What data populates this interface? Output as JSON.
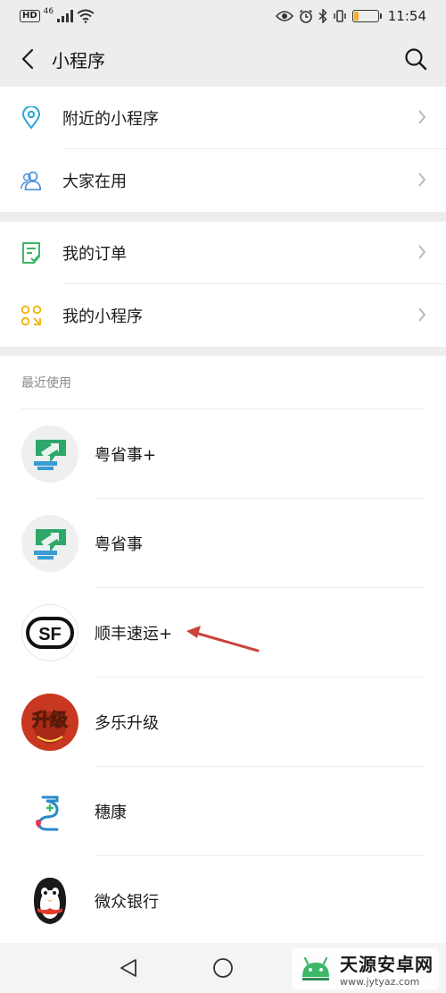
{
  "status_bar": {
    "hd": "HD",
    "network": "46",
    "time": "11:54",
    "battery_level": 0.2,
    "battery_color": "#f2b233"
  },
  "header": {
    "title": "小程序",
    "back_icon": "chevron-left-icon",
    "search_icon": "search-icon"
  },
  "menu_group_1": [
    {
      "label": "附近的小程序",
      "icon": "location-pin-icon",
      "icon_color": "#29a6d8"
    },
    {
      "label": "大家在用",
      "icon": "people-icon",
      "icon_color": "#4a8fd9"
    }
  ],
  "menu_group_2": [
    {
      "label": "我的订单",
      "icon": "order-list-icon",
      "icon_color": "#3cb868"
    },
    {
      "label": "我的小程序",
      "icon": "mini-program-grid-icon",
      "icon_color": "#f0b400"
    }
  ],
  "recent": {
    "header": "最近使用",
    "items": [
      {
        "name": "粤省事+",
        "icon": "yue-sheng-shi-logo-icon"
      },
      {
        "name": "粤省事",
        "icon": "yue-sheng-shi-logo-icon"
      },
      {
        "name": "顺丰速运+",
        "icon": "sf-express-logo-icon",
        "logo_text": "SF"
      },
      {
        "name": "多乐升级",
        "icon": "duole-shengji-logo-icon",
        "logo_text": "升级"
      },
      {
        "name": "穗康",
        "icon": "suikang-logo-icon"
      },
      {
        "name": "微众银行",
        "icon": "webank-penguin-icon"
      }
    ]
  },
  "navbar": {
    "back_icon": "triangle-back-icon",
    "home_icon": "circle-home-icon"
  },
  "watermark": {
    "name": "天源安卓网",
    "url": "www.jytyaz.com"
  },
  "colors": {
    "background": "#ededed",
    "card": "#ffffff",
    "annotation_arrow": "#c9443a"
  }
}
